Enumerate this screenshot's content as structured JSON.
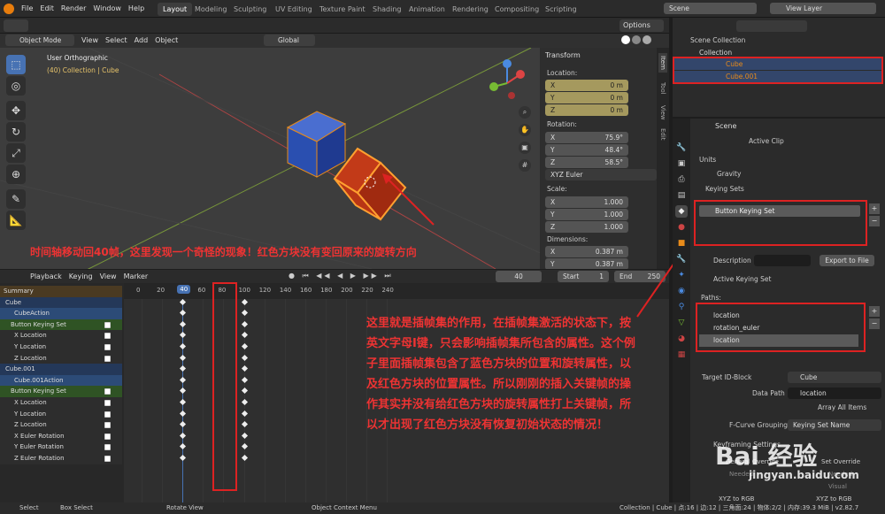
{
  "menu": [
    "File",
    "Edit",
    "Render",
    "Window",
    "Help"
  ],
  "workspaces": [
    "Layout",
    "Modeling",
    "Sculpting",
    "UV Editing",
    "Texture Paint",
    "Shading",
    "Animation",
    "Rendering",
    "Compositing",
    "Scripting"
  ],
  "scene": "Scene",
  "view_layer": "View Layer",
  "viewport": {
    "mode": "Object Mode",
    "menus": [
      "View",
      "Select",
      "Add",
      "Object"
    ],
    "orientation": "Global",
    "options": "Options",
    "view_name": "User Orthographic",
    "collection_info": "(40) Collection | Cube"
  },
  "transform": {
    "title": "Transform",
    "location_label": "Location:",
    "loc": [
      {
        "axis": "X",
        "value": "0 m"
      },
      {
        "axis": "Y",
        "value": "0 m"
      },
      {
        "axis": "Z",
        "value": "0 m"
      }
    ],
    "rotation_label": "Rotation:",
    "rot": [
      {
        "axis": "X",
        "value": "75.9°"
      },
      {
        "axis": "Y",
        "value": "48.4°"
      },
      {
        "axis": "Z",
        "value": "58.5°"
      }
    ],
    "euler": "XYZ Euler",
    "scale_label": "Scale:",
    "scale": [
      {
        "axis": "X",
        "value": "1.000"
      },
      {
        "axis": "Y",
        "value": "1.000"
      },
      {
        "axis": "Z",
        "value": "1.000"
      }
    ],
    "dim_label": "Dimensions:",
    "dim": [
      {
        "axis": "X",
        "value": "0.387 m"
      },
      {
        "axis": "Y",
        "value": "0.387 m"
      }
    ]
  },
  "side_tabs": [
    "Item",
    "Tool",
    "View",
    "Edit"
  ],
  "annotation1": "时间轴移动回40帧，这里发现一个奇怪的现象！红色方块没有变回原来的旋转方向",
  "annotation2": "这里就是插帧集的作用，在插帧集激活的状态下，按英文字母I键，只会影响插帧集所包含的属性。这个例子里面插帧集包含了蓝色方块的位置和旋转属性，以及红色方块的位置属性。所以刚刚的插入关键帧的操作其实并没有给红色方块的旋转属性打上关键帧，所以才出现了红色方块没有恢复初始状态的情况！",
  "timeline": {
    "menus": [
      "Playback",
      "Keying",
      "View",
      "Marker"
    ],
    "current_frame": "40",
    "start_label": "Start",
    "start": "1",
    "end_label": "End",
    "end": "250",
    "ticks": [
      "0",
      "20",
      "40",
      "60",
      "80",
      "100",
      "120",
      "140",
      "160",
      "180",
      "200",
      "220",
      "240"
    ]
  },
  "channels": [
    {
      "label": "Summary",
      "type": "summary"
    },
    {
      "label": "Cube",
      "type": "object"
    },
    {
      "label": "CubeAction",
      "type": "action"
    },
    {
      "label": "Button Keying Set",
      "type": "group"
    },
    {
      "label": "X Location",
      "type": "fcurve"
    },
    {
      "label": "Y Location",
      "type": "fcurve"
    },
    {
      "label": "Z Location",
      "type": "fcurve"
    },
    {
      "label": "Cube.001",
      "type": "object"
    },
    {
      "label": "Cube.001Action",
      "type": "action"
    },
    {
      "label": "Button Keying Set",
      "type": "group"
    },
    {
      "label": "X Location",
      "type": "fcurve"
    },
    {
      "label": "Y Location",
      "type": "fcurve"
    },
    {
      "label": "Z Location",
      "type": "fcurve"
    },
    {
      "label": "X Euler Rotation",
      "type": "fcurve"
    },
    {
      "label": "Y Euler Rotation",
      "type": "fcurve"
    },
    {
      "label": "Z Euler Rotation",
      "type": "fcurve"
    }
  ],
  "outliner": {
    "root": "Scene Collection",
    "collection": "Collection",
    "items": [
      "Cube",
      "Cube.001"
    ]
  },
  "properties": {
    "scene_name": "Scene",
    "active_clip": "Active Clip",
    "sections": [
      "Units",
      "Gravity",
      "Keying Sets"
    ],
    "keying_set": "Button Keying Set",
    "description_label": "Description",
    "export_btn": "Export to File",
    "active_ks": "Active Keying Set",
    "paths_label": "Paths:",
    "paths": [
      "location",
      "rotation_euler",
      "location"
    ],
    "target_label": "Target ID-Block",
    "target": "Cube",
    "data_path_label": "Data Path",
    "data_path": "location",
    "array_all": "Array All Items",
    "fcurve_grouping_label": "F-Curve Grouping",
    "fcurve_grouping": "Keying Set Name",
    "keyframing_settings": "Keyframing Settings",
    "general_override": "General Override",
    "needed": "Needed",
    "visual": "Visual",
    "xyz_rgb": "XYZ to RGB",
    "set_override": "Set Override"
  },
  "status": {
    "select": "Select",
    "box_select": "Box Select",
    "rotate_view": "Rotate View",
    "context_menu": "Object Context Menu",
    "info": "Collection | Cube | 点:16 | 边:12 | 三角面:24 | 物体:2/2 | 内存:39.3 MiB | v2.82.7"
  },
  "watermark": "Bai 经验",
  "watermark_url": "jingyan.baidu.com",
  "colors": {
    "accent": "#4772b3",
    "annotation": "#e02020",
    "keyed_field": "#a5995e"
  }
}
